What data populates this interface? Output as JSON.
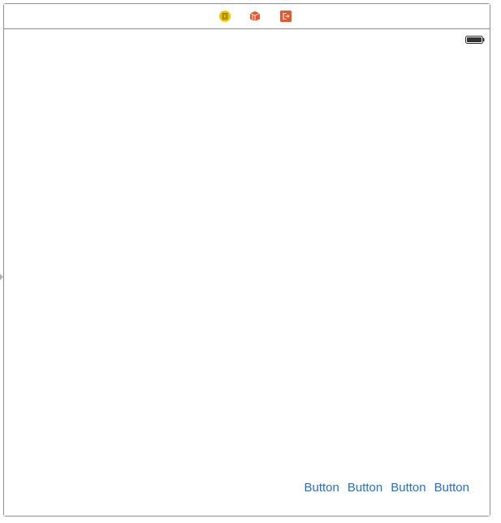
{
  "dock": {
    "icons": [
      "view-controller-icon",
      "first-responder-icon",
      "exit-icon"
    ],
    "colors": {
      "view_controller": "#f0c800",
      "first_responder": "#e8562a",
      "exit": "#e8562a"
    }
  },
  "canvas": {
    "status_bar": {
      "battery_icon": "battery-icon"
    },
    "buttons": [
      {
        "label": "Button"
      },
      {
        "label": "Button"
      },
      {
        "label": "Button"
      },
      {
        "label": "Button"
      }
    ]
  },
  "accent_color": "#1f6fd1"
}
